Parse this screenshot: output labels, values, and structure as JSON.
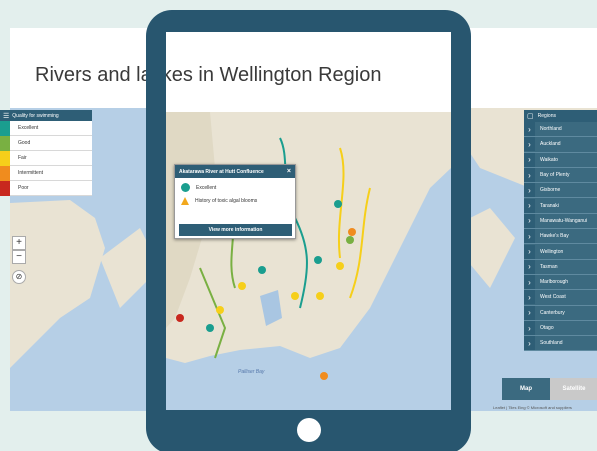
{
  "page": {
    "title": "Rivers and lakes in Wellington Region"
  },
  "legend": {
    "header": "Quality for swimming",
    "items": [
      {
        "label": "Excellent",
        "color": "#1a9e8f"
      },
      {
        "label": "Good",
        "color": "#79b042"
      },
      {
        "label": "Fair",
        "color": "#f6cf1a"
      },
      {
        "label": "Intermittent",
        "color": "#f08c1e"
      },
      {
        "label": "Poor",
        "color": "#c8281e"
      }
    ]
  },
  "zoom": {
    "in": "+",
    "out": "−"
  },
  "regions": {
    "header": "Regions",
    "items": [
      "Northland",
      "Auckland",
      "Waikato",
      "Bay of Plenty",
      "Gisborne",
      "Taranaki",
      "Manawatu-Wanganui",
      "Hawke's Bay",
      "Wellington",
      "Tasman",
      "Marlborough",
      "West Coast",
      "Canterbury",
      "Otago",
      "Southland"
    ]
  },
  "map_buttons": {
    "map": "Map",
    "satellite": "Satellite"
  },
  "attribution": "Leaflet | Tiles Eing © Microsoft and suppliers",
  "popup": {
    "title": "Akatarawa River at Hutt Confluence",
    "close": "×",
    "status_label": "Excellent",
    "warning_label": "History of toxic algal blooms",
    "button_label": "View more information"
  },
  "map_labels": {
    "palliser_bay": "Palliser Bay"
  },
  "colors": {
    "tablet": "#28566f",
    "background": "#e3efed",
    "sea": "#b6cfe6",
    "land": "#e9e3d3"
  }
}
